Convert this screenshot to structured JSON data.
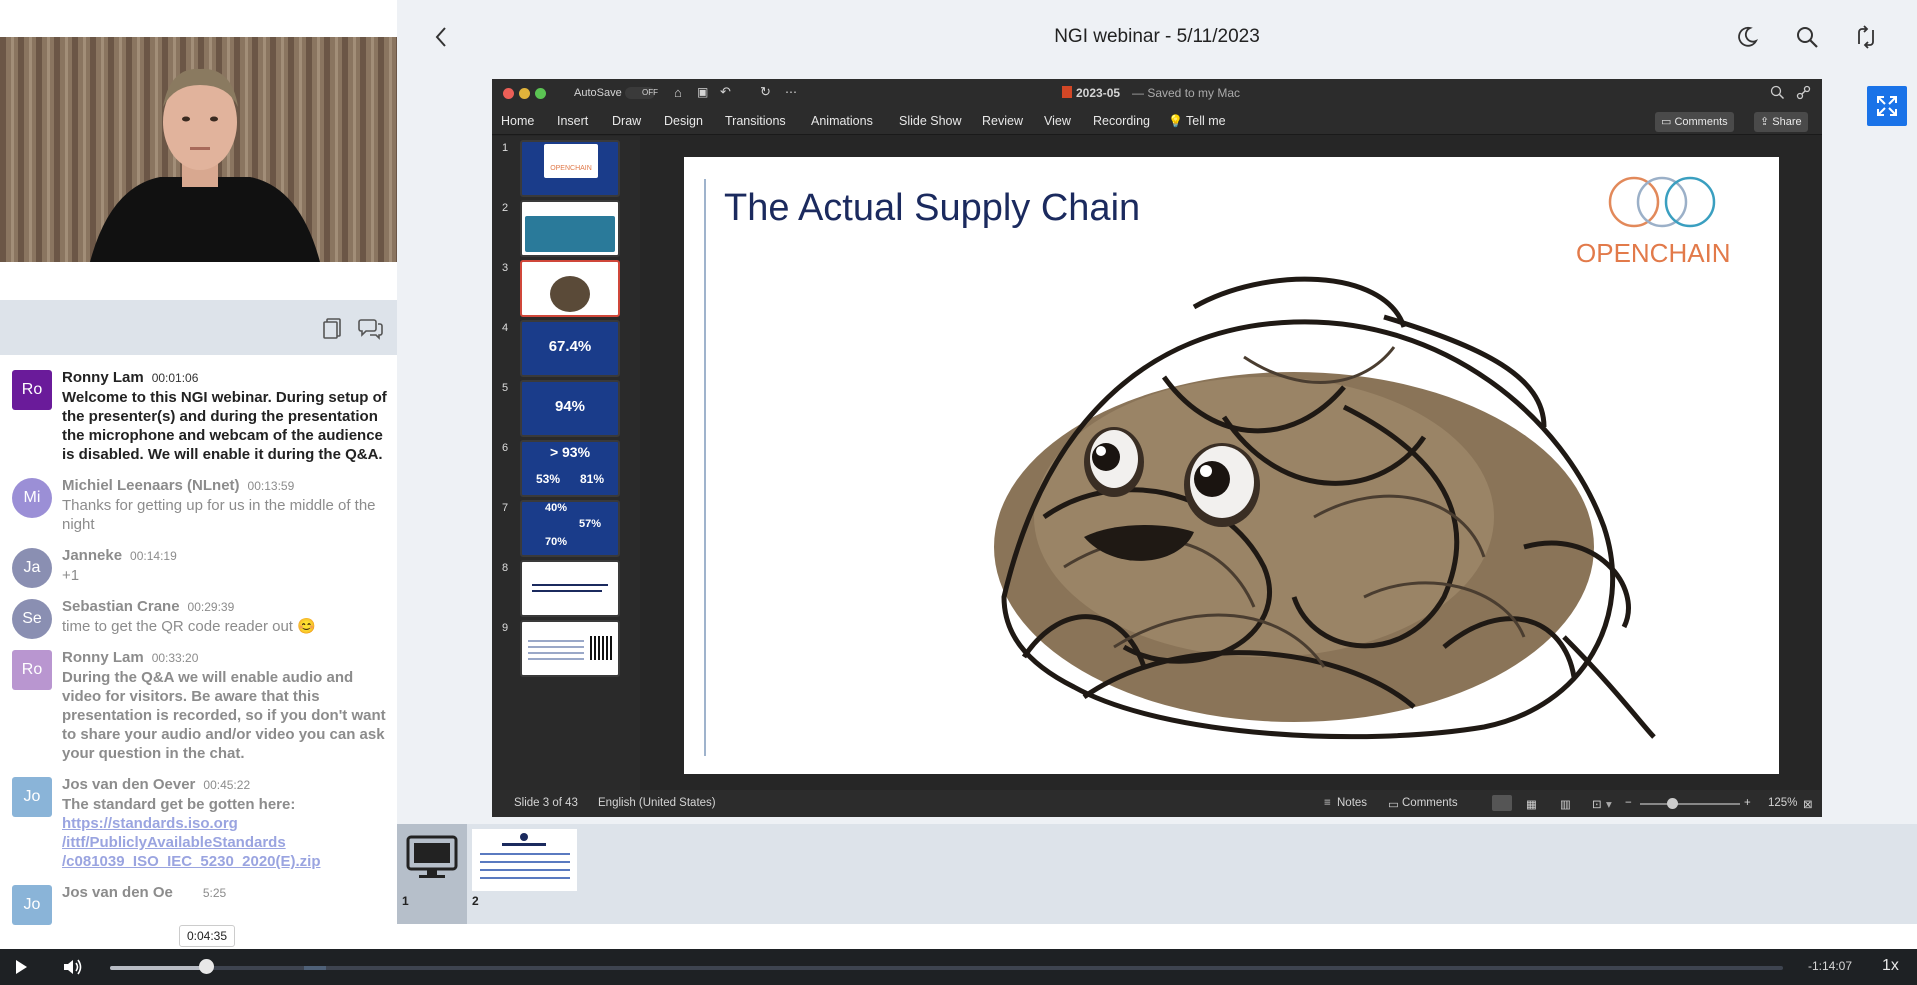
{
  "header": {
    "title": "NGI webinar - 5/11/2023"
  },
  "chat": {
    "messages": [
      {
        "initials": "Ro",
        "name": "Ronny Lam",
        "time": "00:01:06",
        "text": "Welcome to this NGI webinar. During setup of the presenter(s) and during the presentation the microphone and webcam of the audience is disabled. We will enable it during the Q&A.",
        "color": "#6a1b9a"
      },
      {
        "initials": "Mi",
        "name": "Michiel Leenaars (NLnet)",
        "time": "00:13:59",
        "text": "Thanks for getting up for us in the middle of the night",
        "color": "#9b8fd6"
      },
      {
        "initials": "Ja",
        "name": "Janneke",
        "time": "00:14:19",
        "text": "+1",
        "color": "#8a8fb2"
      },
      {
        "initials": "Se",
        "name": "Sebastian Crane",
        "time": "00:29:39",
        "text": "time to get the QR code reader out 😊",
        "color": "#8a8fb2"
      },
      {
        "initials": "Ro",
        "name": "Ronny Lam",
        "time": "00:33:20",
        "text": "During the Q&A we will enable audio and video for visitors. Be aware that this presentation is recorded, so if you don't want to share your audio and/or video you can ask your question in the chat.",
        "color": "#b996d0"
      },
      {
        "initials": "Jo",
        "name": "Jos van den Oever",
        "time": "00:45:22",
        "text": "The standard get be gotten here:",
        "link": "https://standards.iso.org/ittf/PubliclyAvailableStandards/c081039_ISO_IEC_5230_2020(E).zip",
        "link_lines": [
          "https://standards.iso.org",
          "/ittf/PubliclyAvailableStandards",
          "/c081039_ISO_IEC_5230_2020(E).zip"
        ],
        "color": "#8ab4d8"
      },
      {
        "initials": "Jo",
        "name": "Jos van den Oe",
        "time": "5:25",
        "color": "#8ab4d8"
      }
    ]
  },
  "ppt": {
    "autosave": "AutoSave",
    "off": "OFF",
    "file": "2023-05",
    "saved": "— Saved to my Mac",
    "ribbon": [
      "Home",
      "Insert",
      "Draw",
      "Design",
      "Transitions",
      "Animations",
      "Slide Show",
      "Review",
      "View",
      "Recording",
      "Tell me"
    ],
    "comments_btn": "Comments",
    "share_btn": "Share",
    "thumbs": [
      {
        "n": "1",
        "type": "logo",
        "label": "OPENCHAIN"
      },
      {
        "n": "2",
        "type": "map"
      },
      {
        "n": "3",
        "type": "blob"
      },
      {
        "n": "4",
        "type": "blue",
        "value": "67.4%"
      },
      {
        "n": "5",
        "type": "blue",
        "value": "94%"
      },
      {
        "n": "6",
        "type": "blue",
        "value": "> 93%",
        "sub1": "53%",
        "sub2": "81%"
      },
      {
        "n": "7",
        "type": "blue",
        "value": "40%",
        "sub1": "57%",
        "sub2": "70%"
      },
      {
        "n": "8",
        "type": "white"
      },
      {
        "n": "9",
        "type": "qr"
      }
    ],
    "slide_title": "The Actual Supply Chain",
    "logo": "OPENCHAIN",
    "status_slide": "Slide 3 of 43",
    "status_lang": "English (United States)",
    "status_notes": "Notes",
    "status_comments": "Comments",
    "zoom": "125%"
  },
  "strip": {
    "items": [
      "1",
      "2"
    ]
  },
  "player": {
    "tooltip": "0:04:35",
    "remaining": "-1:14:07",
    "rate": "1x",
    "progress": 0.058
  }
}
